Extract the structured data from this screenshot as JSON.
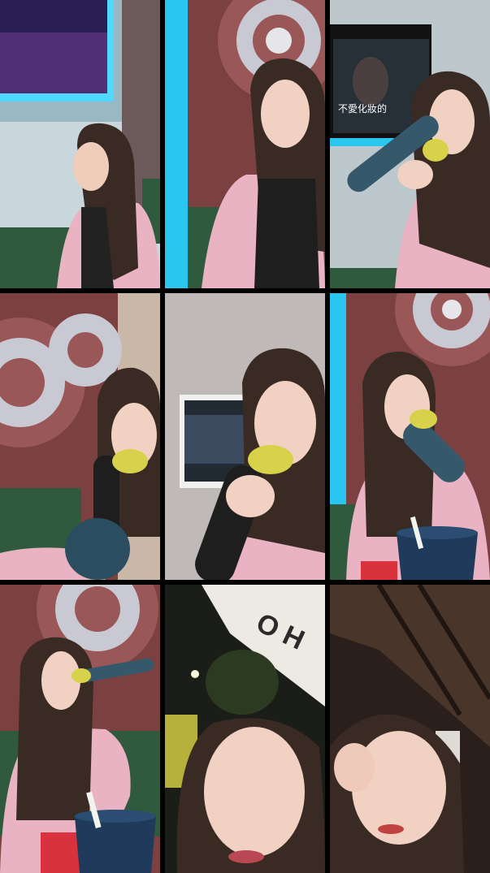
{
  "tiles": [
    {
      "id": "tile-1",
      "scene": "karaoke-room-tv-left"
    },
    {
      "id": "tile-2",
      "scene": "karaoke-room-wall-art"
    },
    {
      "id": "tile-3",
      "scene": "singing-with-tv-lyrics"
    },
    {
      "id": "tile-4",
      "scene": "singing-wall-art"
    },
    {
      "id": "tile-5",
      "scene": "singing-closeup-tv"
    },
    {
      "id": "tile-6",
      "scene": "singing-with-cup"
    },
    {
      "id": "tile-7",
      "scene": "singing-sofa-cup"
    },
    {
      "id": "tile-8",
      "scene": "outdoor-night-sign"
    },
    {
      "id": "tile-9",
      "scene": "outdoor-awning-looking-up"
    }
  ],
  "tv_lyrics": {
    "line_1": "不愛化妝的"
  },
  "colors": {
    "neon_blue": "#29c6ef",
    "sofa_green": "#2f5a3e",
    "jacket_pink": "#e9b3c3",
    "mic_yellow": "#d8d24a",
    "wall_red": "#7b4040"
  }
}
